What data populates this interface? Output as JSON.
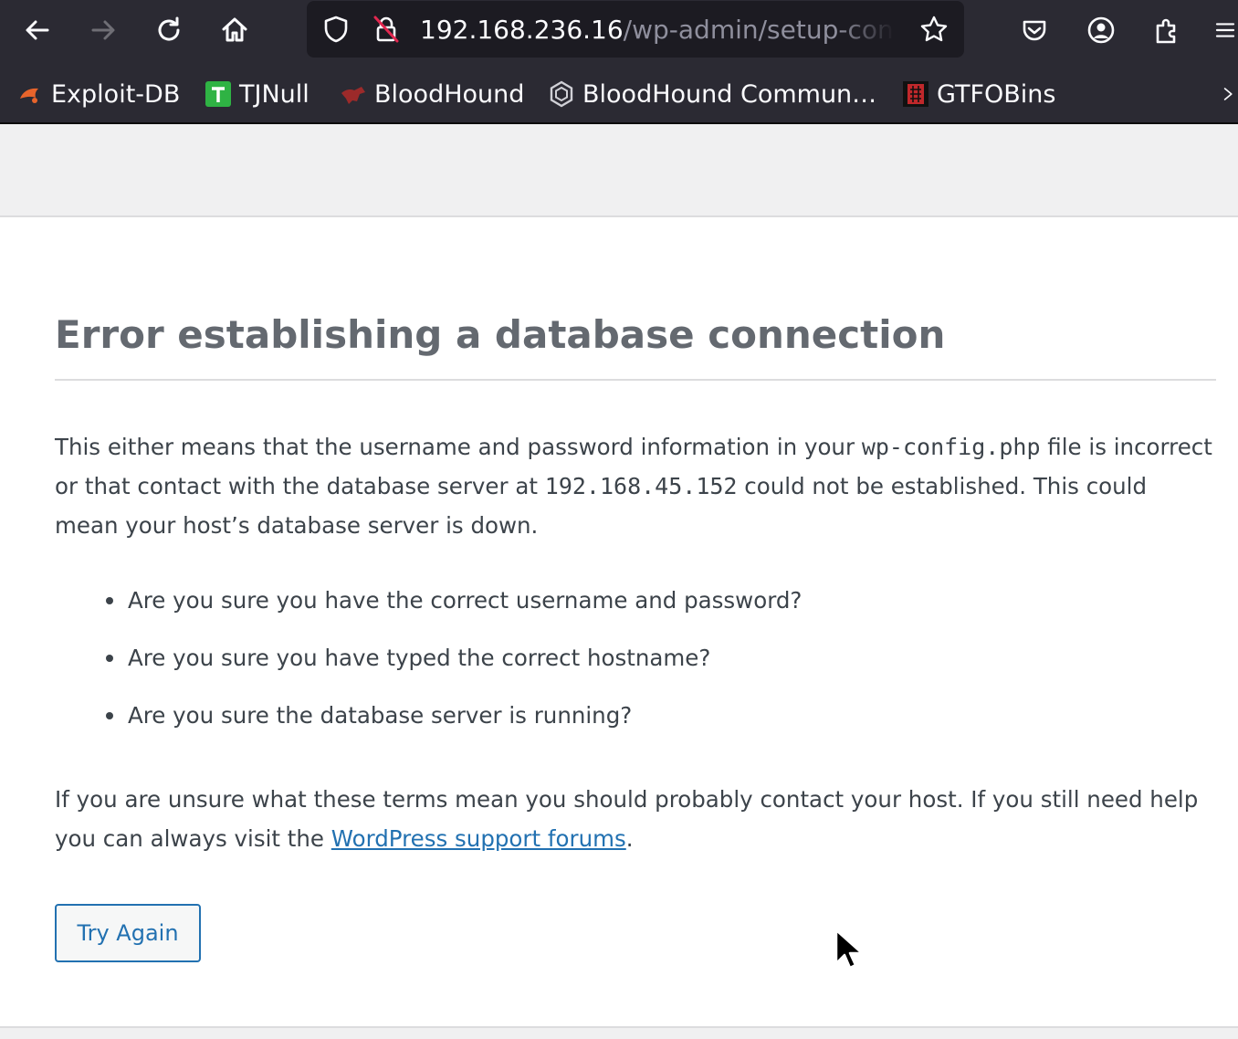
{
  "browser": {
    "nav": {
      "back_icon": "arrow-left-icon",
      "forward_icon": "arrow-right-icon",
      "reload_icon": "reload-icon",
      "home_icon": "home-icon"
    },
    "urlbar": {
      "host": "192.168.236.16",
      "path": "/wp-admin/setup-config.php",
      "icons": [
        "shield-icon",
        "insecure-lock-icon",
        "star-icon"
      ]
    },
    "toolbar_icons": [
      "pocket-icon",
      "account-icon",
      "extensions-icon",
      "menu-icon"
    ],
    "bookmarks": [
      {
        "label": "Exploit-DB",
        "icon": "exploit-db-icon",
        "color": "#e8642b"
      },
      {
        "label": "TJNull",
        "icon": "tjnull-icon",
        "color": "#2fb344"
      },
      {
        "label": "BloodHound",
        "icon": "bloodhound-icon",
        "color": "#b52b2b"
      },
      {
        "label": "BloodHound Commun…",
        "icon": "hexagon-icon",
        "color": "#d0d0d6"
      },
      {
        "label": "GTFOBins",
        "icon": "gtfobins-icon",
        "color": "#c0282b"
      }
    ],
    "overflow_icon": "chevron-right-icon"
  },
  "page": {
    "title": "Error establishing a database connection",
    "intro": {
      "t1": "This either means that the username and password information in your ",
      "code1": "wp-config.php",
      "t2": " file is incorrect or that contact with the database server at ",
      "code2": "192.168.45.152",
      "t3": " could not be established. This could mean your host’s database server is down."
    },
    "bullets": [
      "Are you sure you have the correct username and password?",
      "Are you sure you have typed the correct hostname?",
      "Are you sure the database server is running?"
    ],
    "help": {
      "t1": "If you are unsure what these terms mean you should probably contact your host. If you still need help you can always visit the ",
      "link": "WordPress support forums",
      "t2": "."
    },
    "button_label": "Try Again"
  },
  "colors": {
    "chrome_bg": "#2b2a33",
    "urlbar_bg": "#1c1b22",
    "page_bg": "#f0f0f1",
    "title": "#646970",
    "text": "#3c434a",
    "link": "#2271b1"
  }
}
